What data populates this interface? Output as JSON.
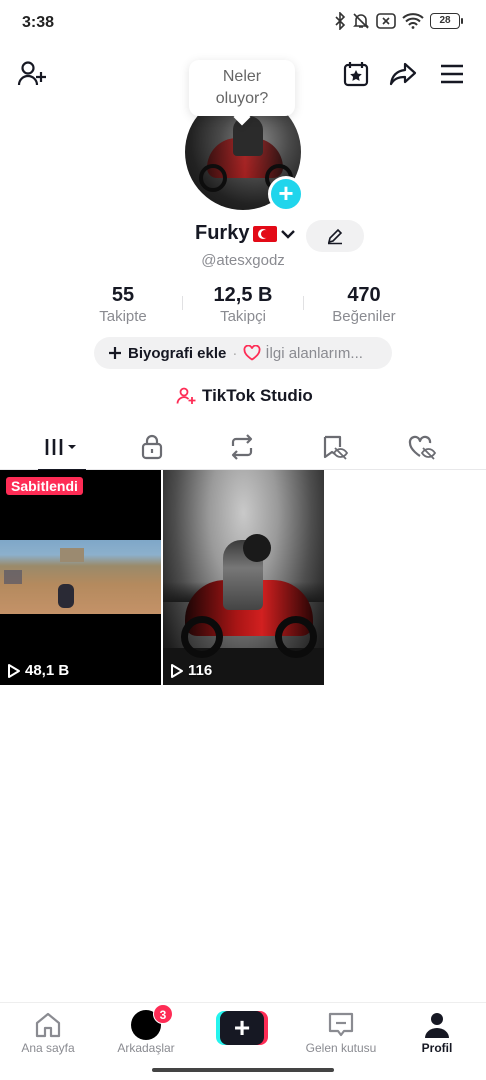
{
  "status_bar": {
    "time": "3:38",
    "battery": "28",
    "icons": [
      "bluetooth-icon",
      "mute-icon",
      "no-sim-icon",
      "wifi-icon",
      "battery-icon"
    ]
  },
  "top_nav": {
    "left_icon": "add-friend-icon",
    "right_icons": [
      "calendar-star-icon",
      "share-icon",
      "menu-icon"
    ]
  },
  "tooltip": {
    "line1": "Neler",
    "line2": "oluyor?"
  },
  "profile": {
    "display_name": "Furky",
    "username": "@atesxgodz",
    "stats": [
      {
        "value": "55",
        "label": "Takipte"
      },
      {
        "value": "12,5 B",
        "label": "Takipçi"
      },
      {
        "value": "470",
        "label": "Beğeniler"
      }
    ],
    "add_bio_label": "Biyografi ekle",
    "interests_label": "İlgi alanlarım...",
    "studio_label": "TikTok Studio"
  },
  "tabs": [
    {
      "name": "videos-tab",
      "icon": "grid-icon",
      "active": true
    },
    {
      "name": "private-tab",
      "icon": "lock-icon",
      "active": false
    },
    {
      "name": "reposts-tab",
      "icon": "repost-icon",
      "active": false
    },
    {
      "name": "favorites-tab",
      "icon": "bookmark-hidden-icon",
      "active": false
    },
    {
      "name": "liked-tab",
      "icon": "heart-hidden-icon",
      "active": false
    }
  ],
  "videos": [
    {
      "pinned_label": "Sabitlendi",
      "views": "48,1 B"
    },
    {
      "views": "116"
    }
  ],
  "bottom_nav": {
    "home_label": "Ana sayfa",
    "friends_label": "Arkadaşlar",
    "friends_badge": "3",
    "create_label": "+",
    "inbox_label": "Gelen kutusu",
    "profile_label": "Profil"
  },
  "colors": {
    "accent_red": "#fe2c55",
    "accent_cyan": "#20d5ec",
    "text_primary": "#161823",
    "text_secondary": "#8a8b91"
  }
}
